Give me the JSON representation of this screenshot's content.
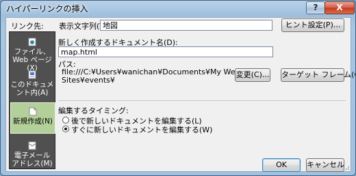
{
  "window": {
    "title": "ハイパーリンクの挿入",
    "help_label": "?",
    "close_label": "X"
  },
  "link_to": {
    "label": "リンク先:",
    "items": [
      {
        "label": "ファイル、Web ページ(X)",
        "icon": "web-page-icon"
      },
      {
        "label": "このドキュメント内(A)",
        "icon": "document-icon"
      },
      {
        "label": "新規作成(N)",
        "icon": "new-document-icon",
        "selected": true
      },
      {
        "label": "電子メール アドレス(M)",
        "icon": "email-icon"
      }
    ]
  },
  "display_text": {
    "label": "表示文字列(T):",
    "value": "地図"
  },
  "screen_tip_button": "ヒント設定(P)...",
  "new_document_name": {
    "label": "新しく作成するドキュメント名(D):",
    "value": "map.html"
  },
  "path": {
    "label": "パス:",
    "value_line1": "file:///C:¥Users¥wanichan¥Documents¥My Web",
    "value_line2": "Sites¥events¥"
  },
  "change_button": "変更(C)...",
  "target_frame_button": "ターゲット フレーム(G)...",
  "when_to_edit": {
    "label": "編集するタイミング:",
    "options": [
      {
        "label": "後で新しいドキュメントを編集する(L)",
        "checked": false
      },
      {
        "label": "すぐに新しいドキュメントを編集する(W)",
        "checked": true
      }
    ]
  },
  "ok_button": "OK",
  "cancel_button": "キャンセル"
}
